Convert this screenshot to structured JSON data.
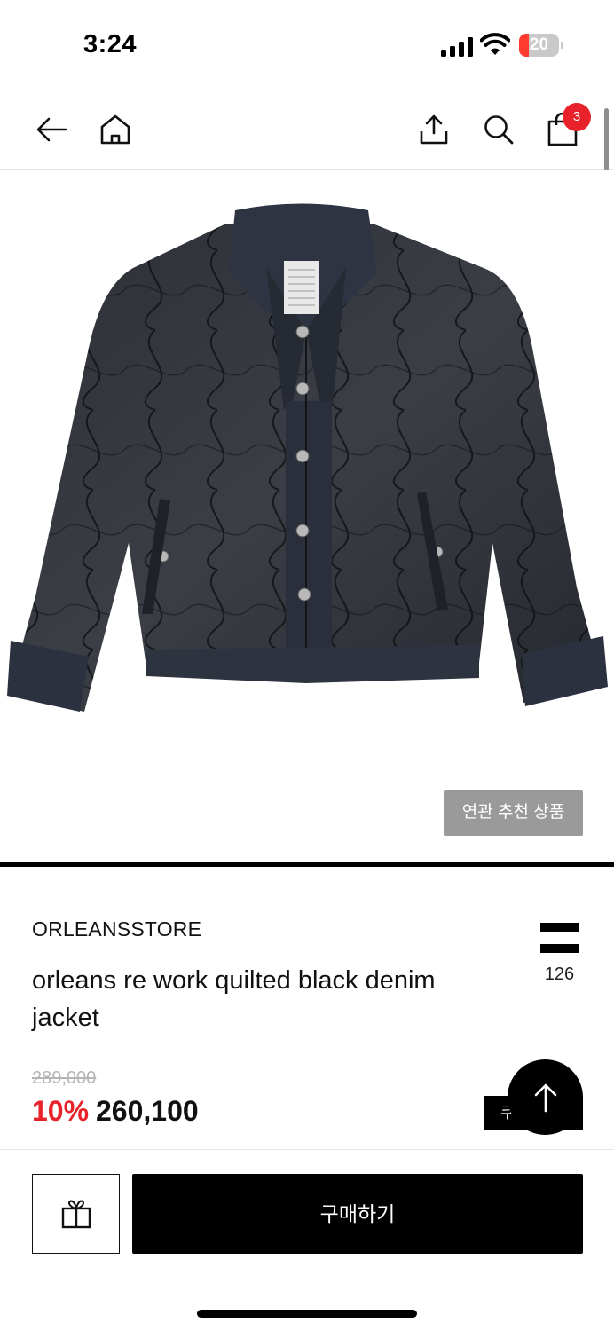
{
  "status_bar": {
    "time": "3:24",
    "battery_level": "20",
    "battery_color": "#ff3b30",
    "icons": [
      "signal-icon",
      "wifi-icon",
      "battery-icon"
    ]
  },
  "nav": {
    "icons": [
      "back-arrow-icon",
      "home-icon",
      "share-icon",
      "search-icon",
      "shopping-bag-icon"
    ],
    "cart_count": "3",
    "badge_color": "#e8222a"
  },
  "product": {
    "image_subject": "black quilted denim jacket",
    "related_button": "연관 추천 상품",
    "brand": "ORLEANSSTORE",
    "name": "orleans re work quilted black denim jacket",
    "menu_count": "126",
    "original_price": "289,000",
    "discount_rate": "10%",
    "sale_price": "260,100",
    "coupon_partial": "쿠",
    "discount_color": "#e8222a"
  },
  "bottom_bar": {
    "gift_icon": "gift-icon",
    "buy_label": "구매하기"
  },
  "scroll_top_icon": "arrow-up-icon"
}
